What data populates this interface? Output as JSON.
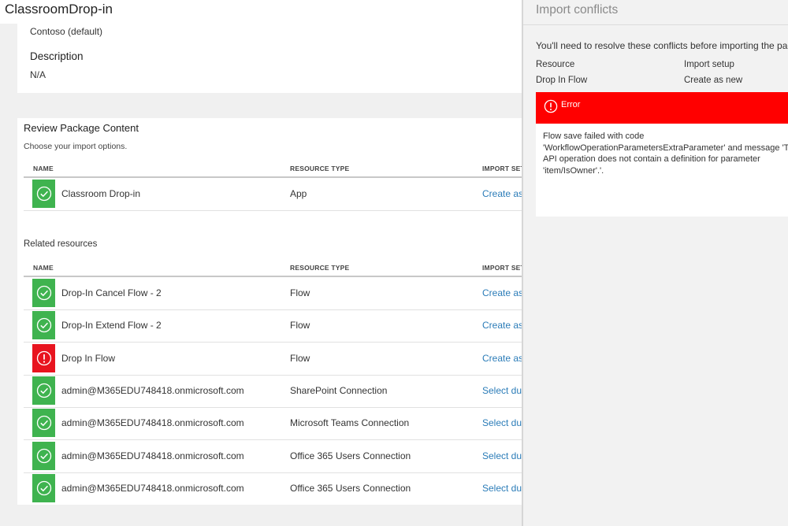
{
  "header": {
    "title": "ClassroomDrop-in"
  },
  "details": {
    "environment_value": "Contoso (default)",
    "description_label": "Description",
    "description_value": "N/A"
  },
  "review": {
    "title": "Review Package Content",
    "subtitle": "Choose your import options.",
    "columns": {
      "name": "NAME",
      "resource_type": "RESOURCE TYPE",
      "import_setup": "IMPORT SET"
    },
    "rows": [
      {
        "status": "ok",
        "name": "Classroom Drop-in",
        "type": "App",
        "action": "Create as"
      }
    ]
  },
  "related": {
    "title": "Related resources",
    "columns": {
      "name": "NAME",
      "resource_type": "RESOURCE TYPE",
      "import_setup": "IMPORT SET"
    },
    "rows": [
      {
        "status": "ok",
        "name": "Drop-In Cancel Flow - 2",
        "type": "Flow",
        "action": "Create as"
      },
      {
        "status": "ok",
        "name": "Drop-In Extend Flow - 2",
        "type": "Flow",
        "action": "Create as"
      },
      {
        "status": "error",
        "name": "Drop In Flow",
        "type": "Flow",
        "action": "Create as"
      },
      {
        "status": "ok",
        "name": "admin@M365EDU748418.onmicrosoft.com",
        "type": "SharePoint Connection",
        "action": "Select dur"
      },
      {
        "status": "ok",
        "name": "admin@M365EDU748418.onmicrosoft.com",
        "type": "Microsoft Teams Connection",
        "action": "Select dur"
      },
      {
        "status": "ok",
        "name": "admin@M365EDU748418.onmicrosoft.com",
        "type": "Office 365 Users Connection",
        "action": "Select dur"
      },
      {
        "status": "ok",
        "name": "admin@M365EDU748418.onmicrosoft.com",
        "type": "Office 365 Users Connection",
        "action": "Select dur"
      }
    ]
  },
  "panel": {
    "title": "Import conflicts",
    "intro": "You'll need to resolve these conflicts before importing the pac",
    "resource_label": "Resource",
    "setup_label": "Import setup",
    "resource_value": "Drop In Flow",
    "setup_value": "Create as new",
    "error_title": "Error",
    "error_lines": [
      "Flow save failed with code",
      "'WorkflowOperationParametersExtraParameter' and message 'Th",
      "API operation does not contain a definition for parameter",
      "'item/IsOwner'.'."
    ]
  },
  "colors": {
    "success": "#3fb34f",
    "error": "#e8141f",
    "error_banner": "#ff0000",
    "link": "#2b7cb8"
  },
  "icons": {
    "success": "check-circle-icon",
    "error": "exclamation-circle-icon"
  }
}
